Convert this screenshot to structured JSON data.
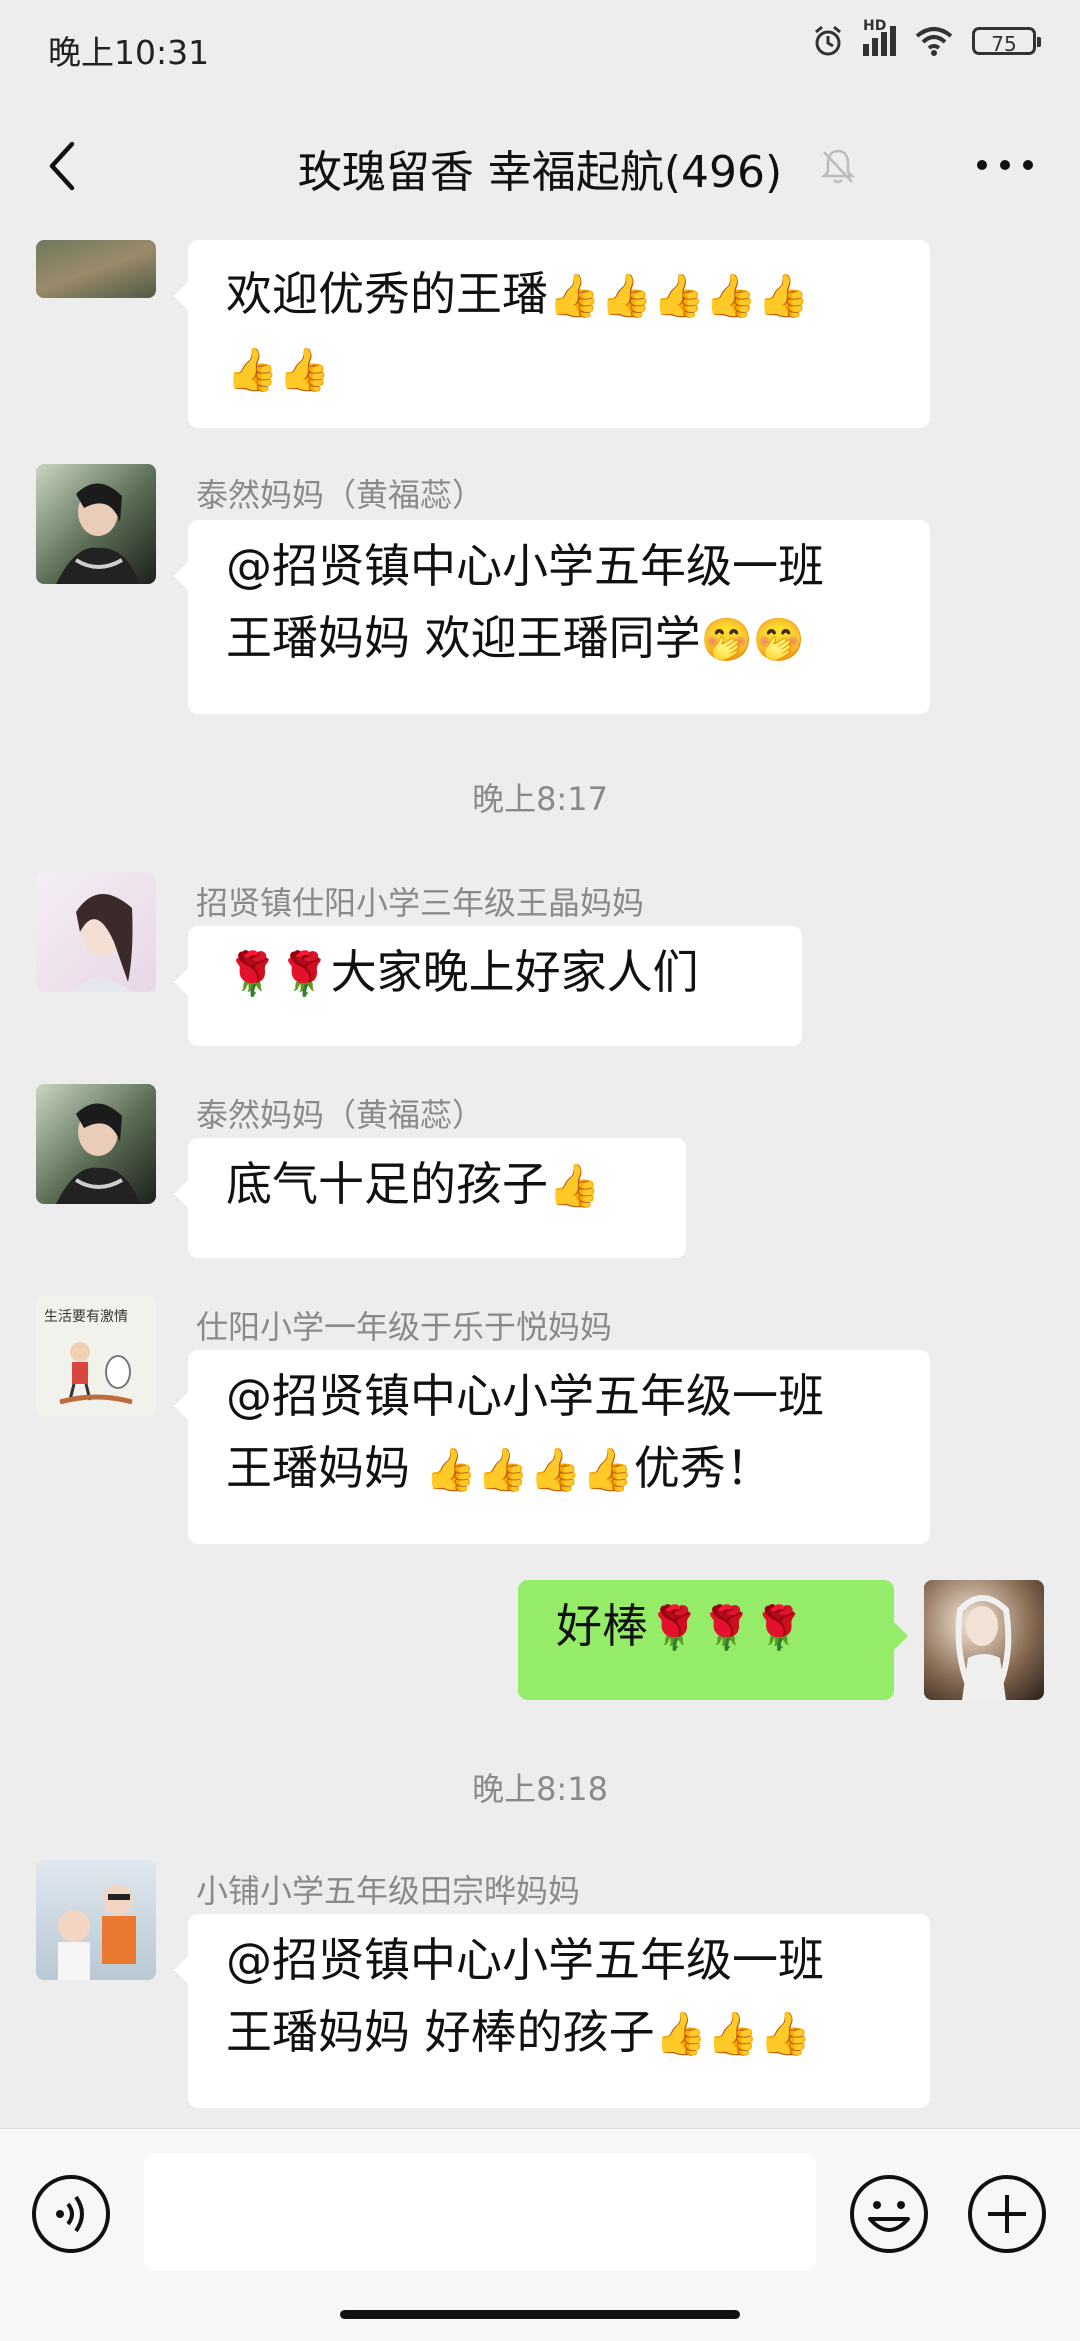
{
  "status": {
    "time": "晚上10:31",
    "battery": "75",
    "network": "HD"
  },
  "header": {
    "title": "玫瑰留香  幸福起航(496)"
  },
  "messages": [
    {
      "sender": "",
      "line1": "欢迎优秀的王璠",
      "line1_emoji": "👍👍👍👍👍",
      "line2_emoji": "👍👍"
    },
    {
      "sender": "泰然妈妈（黄福蕊）",
      "line1": "@招贤镇中心小学五年级一班",
      "line2": "王璠妈妈  欢迎王璠同学",
      "line2_emoji": "🤭🤭"
    },
    {
      "time": "晚上8:17"
    },
    {
      "sender": "招贤镇仕阳小学三年级王晶妈妈",
      "line1_emoji": "🌹🌹",
      "line1": "大家晚上好家人们"
    },
    {
      "sender": "泰然妈妈（黄福蕊）",
      "line1": "底气十足的孩子",
      "line1_emoji": "👍"
    },
    {
      "sender": "仕阳小学一年级于乐于悦妈妈",
      "avatar_text": "生活要有激情",
      "line1": "@招贤镇中心小学五年级一班",
      "line2": "王璠妈妈 ",
      "line2_emoji": "👍👍👍👍",
      "line2_tail": "优秀！"
    },
    {
      "mine": true,
      "line1": "好棒",
      "line1_emoji": "🌹🌹🌹"
    },
    {
      "time": "晚上8:18"
    },
    {
      "sender": "小铺小学五年级田宗晔妈妈",
      "line1": "@招贤镇中心小学五年级一班",
      "line2": "王璠妈妈  好棒的孩子",
      "line2_emoji": "👍👍👍"
    }
  ]
}
